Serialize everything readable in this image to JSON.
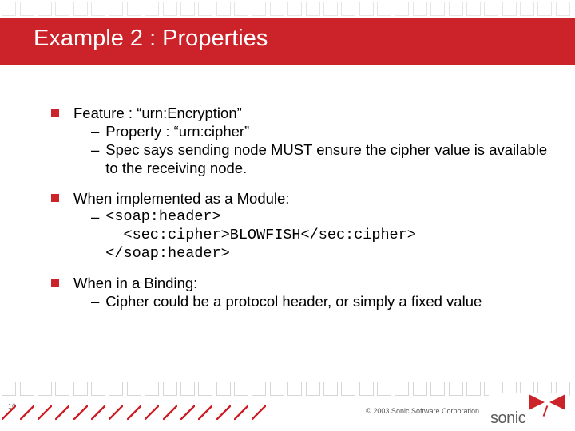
{
  "slide": {
    "title": "Example 2 : Properties",
    "page_number": "10",
    "copyright": "© 2003 Sonic Software Corporation",
    "logo_text": "sonic"
  },
  "bullets": [
    {
      "text": "Feature : “urn:Encryption”",
      "subs": [
        {
          "text": "Property : “urn:cipher”",
          "mono": false
        },
        {
          "text": "Spec says sending node MUST ensure the cipher value is available to the receiving node.",
          "mono": false
        }
      ]
    },
    {
      "text": "When implemented as a Module:",
      "subs": [
        {
          "text": "<soap:header>\n  <sec:cipher>BLOWFISH</sec:cipher>\n</soap:header>",
          "mono": true
        }
      ]
    },
    {
      "text": "When in a Binding:",
      "subs": [
        {
          "text": "Cipher could be a protocol header, or simply a fixed value",
          "mono": false
        }
      ]
    }
  ]
}
